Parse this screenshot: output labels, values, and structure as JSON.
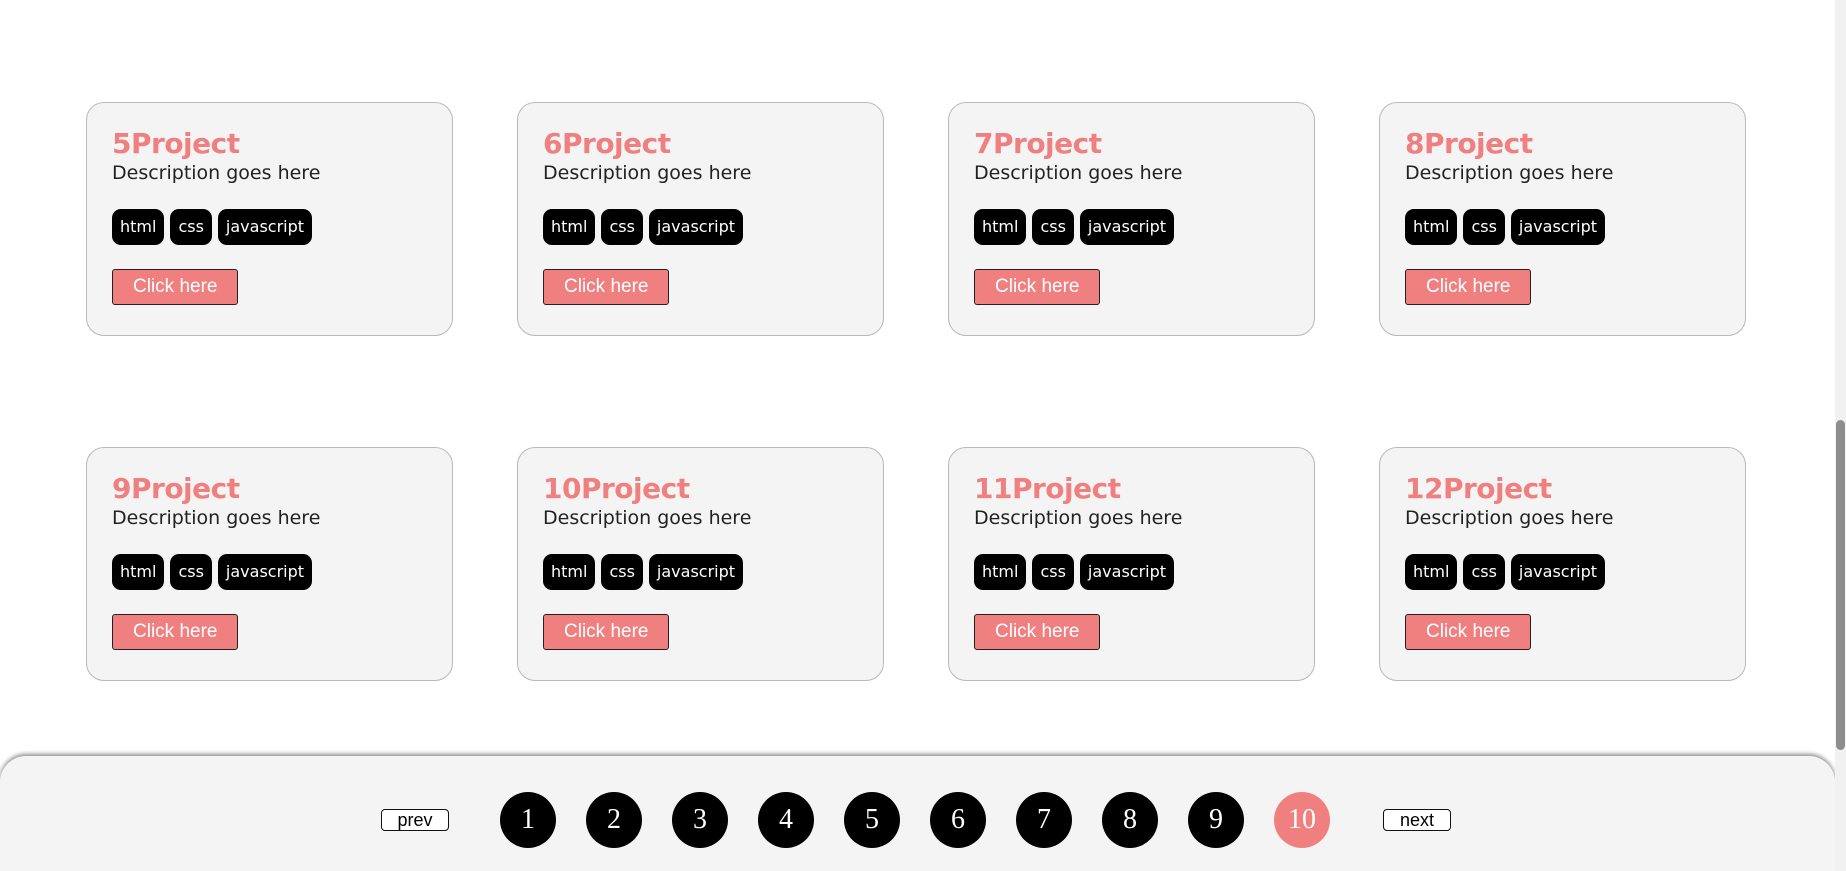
{
  "projects": [
    {
      "title": "5Project",
      "description": "Description goes here",
      "tags": [
        "html",
        "css",
        "javascript"
      ],
      "button": "Click here"
    },
    {
      "title": "6Project",
      "description": "Description goes here",
      "tags": [
        "html",
        "css",
        "javascript"
      ],
      "button": "Click here"
    },
    {
      "title": "7Project",
      "description": "Description goes here",
      "tags": [
        "html",
        "css",
        "javascript"
      ],
      "button": "Click here"
    },
    {
      "title": "8Project",
      "description": "Description goes here",
      "tags": [
        "html",
        "css",
        "javascript"
      ],
      "button": "Click here"
    },
    {
      "title": "9Project",
      "description": "Description goes here",
      "tags": [
        "html",
        "css",
        "javascript"
      ],
      "button": "Click here"
    },
    {
      "title": "10Project",
      "description": "Description goes here",
      "tags": [
        "html",
        "css",
        "javascript"
      ],
      "button": "Click here"
    },
    {
      "title": "11Project",
      "description": "Description goes here",
      "tags": [
        "html",
        "css",
        "javascript"
      ],
      "button": "Click here"
    },
    {
      "title": "12Project",
      "description": "Description goes here",
      "tags": [
        "html",
        "css",
        "javascript"
      ],
      "button": "Click here"
    }
  ],
  "pagination": {
    "prev_label": "prev",
    "next_label": "next",
    "pages": [
      "1",
      "2",
      "3",
      "4",
      "5",
      "6",
      "7",
      "8",
      "9",
      "10"
    ],
    "current_page": "10"
  },
  "colors": {
    "accent": "#f08080",
    "tag_bg": "#000000",
    "card_bg": "#f4f4f4"
  }
}
